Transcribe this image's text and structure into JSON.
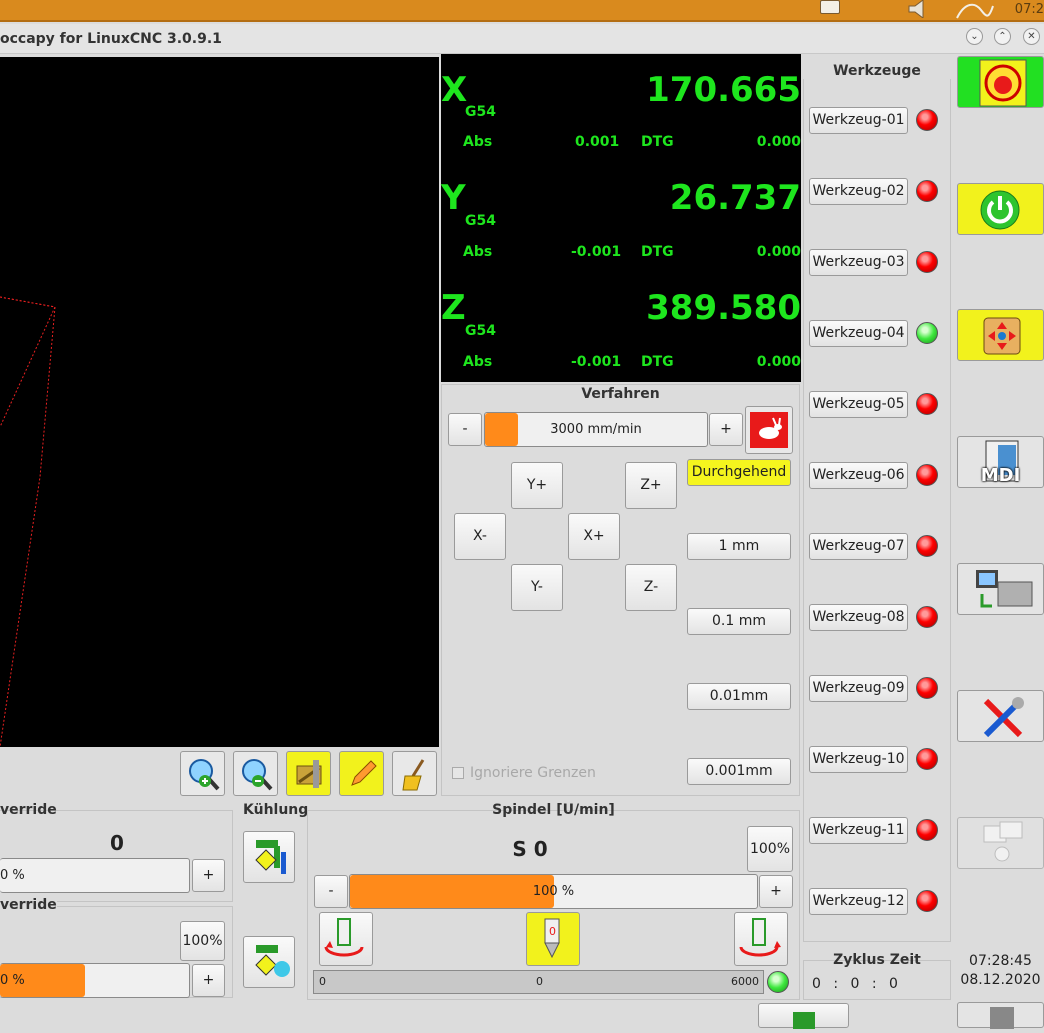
{
  "topbar": {
    "clock": "07:2"
  },
  "window": {
    "title": "occapy for LinuxCNC 3.0.9.1"
  },
  "dro": {
    "x": {
      "letter": "X",
      "value": "170.665",
      "coord": "G54",
      "abs_label": "Abs",
      "abs": "0.001",
      "dtg_label": "DTG",
      "dtg": "0.000"
    },
    "y": {
      "letter": "Y",
      "value": "26.737",
      "coord": "G54",
      "abs_label": "Abs",
      "abs": "-0.001",
      "dtg_label": "DTG",
      "dtg": "0.000"
    },
    "z": {
      "letter": "Z",
      "value": "389.580",
      "coord": "G54",
      "abs_label": "Abs",
      "abs": "-0.001",
      "dtg_label": "DTG",
      "dtg": "0.000"
    }
  },
  "jog": {
    "title": "Verfahren",
    "minus": "-",
    "plus": "+",
    "speed_label": "3000 mm/min",
    "speed_fraction": 0.15,
    "buttons": {
      "yplus": "Y+",
      "yminus": "Y-",
      "xplus": "X+",
      "xminus": "X-",
      "zplus": "Z+",
      "zminus": "Z-"
    },
    "increments": [
      "Durchgehend",
      "1 mm",
      "0.1 mm",
      "0.01mm",
      "0.001mm"
    ],
    "ignore_limits": "Ignoriere Grenzen"
  },
  "tools": {
    "title": "Werkzeuge",
    "items": [
      {
        "label": "Werkzeug-01",
        "state": "red"
      },
      {
        "label": "Werkzeug-02",
        "state": "red"
      },
      {
        "label": "Werkzeug-03",
        "state": "red"
      },
      {
        "label": "Werkzeug-04",
        "state": "green"
      },
      {
        "label": "Werkzeug-05",
        "state": "red"
      },
      {
        "label": "Werkzeug-06",
        "state": "red"
      },
      {
        "label": "Werkzeug-07",
        "state": "red"
      },
      {
        "label": "Werkzeug-08",
        "state": "red"
      },
      {
        "label": "Werkzeug-09",
        "state": "red"
      },
      {
        "label": "Werkzeug-10",
        "state": "red"
      },
      {
        "label": "Werkzeug-11",
        "state": "red"
      },
      {
        "label": "Werkzeug-12",
        "state": "red"
      }
    ]
  },
  "sidebar": {
    "mdi_label": "MDI"
  },
  "feed_override": {
    "title": "verride",
    "value": "0",
    "pct_label": "0 %",
    "plus": "+"
  },
  "max_override": {
    "title": "verride",
    "reset": "100%",
    "pct_label": "0 %",
    "plus": "+",
    "fraction": 0.45
  },
  "coolant": {
    "title": "Kühlung"
  },
  "spindle": {
    "title": "Spindel [U/min]",
    "value": "S 0",
    "reset": "100%",
    "minus": "-",
    "plus": "+",
    "pct_label": "100 %",
    "pct_fraction": 0.5,
    "bar_min": "0",
    "bar_mid": "0",
    "bar_max": "6000"
  },
  "cycle": {
    "title": "Zyklus Zeit",
    "value": "0 : 0 : 0"
  },
  "clock": {
    "time": "07:28:45",
    "date": "08.12.2020"
  },
  "colors": {
    "dro_green": "#1ee61e",
    "accent_orange": "#ff8a1a",
    "highlight_yellow": "#f2f21c"
  }
}
